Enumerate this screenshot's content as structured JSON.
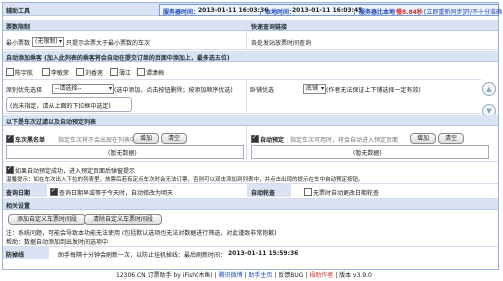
{
  "header": {
    "title": "辅助工具",
    "server_time_label": "服务器时间：",
    "server_time": "2013-01-11 16:03:36",
    "local_time_label": "，本地时间：",
    "local_time": "2013-01-11 16:03:45",
    "compare_label": "，服务器比本地",
    "compare_value": "慢8.84秒",
    "sync_link": "[立即重新同步]",
    "auto_sync_link": "开/不十分准确"
  },
  "row1": {
    "left_title": "票数限制",
    "right_title": "快速查询链接"
  },
  "row2": {
    "min_label": "最小票数",
    "min_value": "(无限制)",
    "min_hint": "只提示余票大于最小票数的车次",
    "right_text": "各处发站放票时间查询"
  },
  "auto_add": {
    "title": "自动添加乘客 (加入此列表的乘客将会自动在提交订单的页面中添加上，最多选五位)",
    "passengers": [
      "陈宇航",
      "李敏荣",
      "刘香莲",
      "薄江",
      "谭潇梅"
    ]
  },
  "seat": {
    "label": "席别优先选择",
    "select": "--请选择--",
    "hint": "(选中添加，点击按钮删除；按添加顺序优选)",
    "empty": "(尚未指定，请从上面的下拉框中选定)",
    "train_label": "卧铺优选",
    "train_select": "底铺",
    "train_hint": "(作者无法保证上下铺选择一定有效)"
  },
  "filter": {
    "title": "以下是车次过滤以及自动预定列表",
    "black_label": "车次黑名单",
    "black_hint": "指定车次将不会出现在列表中",
    "add": "增加",
    "clear": "清空",
    "black_empty": "(暂无数据)",
    "auto_label": "自动预定",
    "auto_hint": "指定车次可用时，将会自动进入预定页面",
    "auto_empty": "(暂无数据)"
  },
  "notice": {
    "line1": "如果自动预定成功，进入预定页面后弹窗提示",
    "line2": "温馨提示：如在车次出入下拉的列表里，放票后若有定点车次时会无法订票，否则可以双击添加到列表中，并点击出现的提示在车中自动预定按钮。"
  },
  "query_date": {
    "label": "查询日期",
    "hint": "查询日期早或等于今天时，自动修改为明天",
    "auto_label": "自动轮查",
    "auto_hint": "无票时自动更改日期轮查"
  },
  "related": {
    "title": "相关设置",
    "add_btn": "添加自定义车票时间段",
    "clear_btn": "清除自定义车票时间段",
    "note1": "注：系统问题，可能会导致本功能无法使用 (包括默认选项也无法对数据进行筛选，对此谨致非常抱歉)",
    "note2": "帮助：数据自动添加到出发时间选项中"
  },
  "anti": {
    "label": "防掉线",
    "text": "助手每隔十分钟会刷新一次，以防止挂机掉线：最后刷新时间：",
    "time": "2013-01-11 15:59:36"
  },
  "footer": {
    "brand": "12306.CN 订票助手 by iFish(木鱼)",
    "sep1": " | ",
    "weibo": "腾讯微博",
    "sep2": " | ",
    "home": "助手主页",
    "sep3": " | 反馈BUG | ",
    "donate": "捐助作者",
    "version": " | 版本 v3.9.0"
  }
}
